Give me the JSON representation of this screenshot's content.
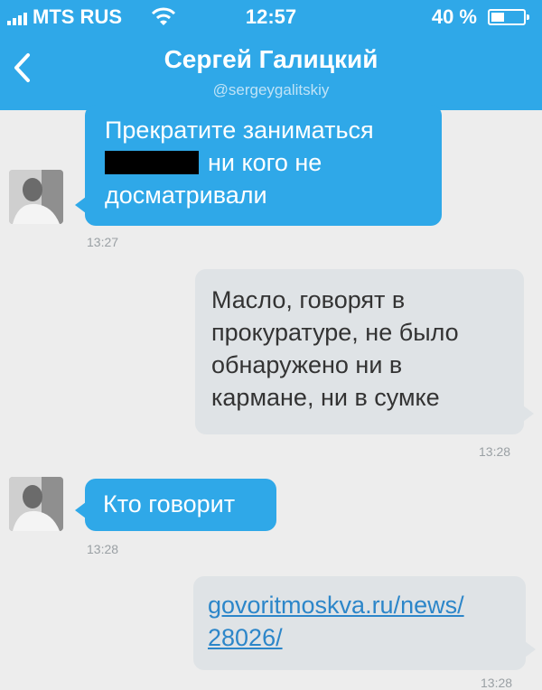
{
  "status_bar": {
    "carrier": "MTS RUS",
    "time": "12:57",
    "battery_percent": "40 %",
    "battery_level": 0.4,
    "icons": [
      "signal-icon",
      "wifi-icon",
      "battery-icon"
    ]
  },
  "header": {
    "back_icon": "chevron-left-icon",
    "name": "Сергей Галицкий",
    "handle": "@sergeygalitskiy"
  },
  "messages": [
    {
      "direction": "incoming",
      "lines": [
        "Прекратите заниматься",
        "ни кого не",
        "досматривали"
      ],
      "redacted": true,
      "time": "13:27"
    },
    {
      "direction": "outgoing",
      "lines": [
        "Масло, говорят в",
        "прокуратуре, не было",
        "обнаружено ни в",
        "кармане, ни в сумке"
      ],
      "time": "13:28"
    },
    {
      "direction": "incoming",
      "lines": [
        "Кто говорит"
      ],
      "time": "13:28"
    },
    {
      "direction": "outgoing",
      "lines": [
        "govoritmoskva.ru/news/",
        "28026/"
      ],
      "is_link": true,
      "time": "13:28"
    }
  ],
  "colors": {
    "accent": "#2fa8e8",
    "incoming_bubble": "#2fa8e8",
    "outgoing_bubble": "#dfe3e6",
    "link": "#2c86c9",
    "background": "#ededed"
  }
}
